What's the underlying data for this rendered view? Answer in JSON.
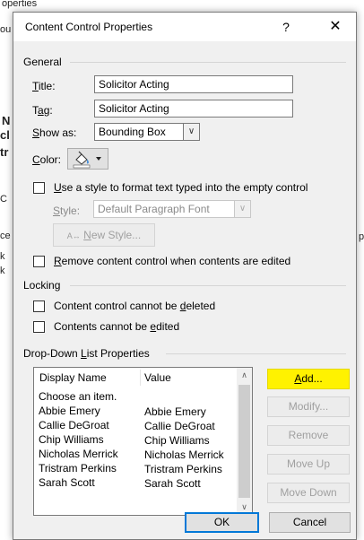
{
  "background_doc": {
    "fragments": [
      "operties",
      "ou",
      "N",
      "cl",
      "tr",
      "C",
      "ce",
      "k",
      "k",
      "p"
    ]
  },
  "dialog": {
    "title": "Content Control Properties",
    "help_glyph": "?",
    "close_glyph": "✕",
    "general": {
      "header": "General",
      "title_label_u": "T",
      "title_label_rest": "itle:",
      "title_value": "Solicitor Acting",
      "tag_label_pre": "T",
      "tag_label_u": "a",
      "tag_label_rest": "g:",
      "tag_value": "Solicitor Acting",
      "show_as_label_u": "S",
      "show_as_label_rest": "how as:",
      "show_as_value": "Bounding Box",
      "color_label_u": "C",
      "color_label_rest": "olor:",
      "use_style_u": "U",
      "use_style_rest": "se a style to format text typed into the empty control",
      "style_label_u": "S",
      "style_label_rest": "tyle:",
      "style_value": "Default Paragraph Font",
      "new_style_u": "N",
      "new_style_rest": "ew Style...",
      "remove_u": "R",
      "remove_rest": "emove content control when contents are edited"
    },
    "locking": {
      "header": "Locking",
      "cannot_delete_pre": "Content control cannot be ",
      "cannot_delete_u": "d",
      "cannot_delete_post": "eleted",
      "cannot_edit_pre": "Contents cannot be ",
      "cannot_edit_u": "e",
      "cannot_edit_post": "dited"
    },
    "dropdown": {
      "header_pre": "Drop-Down ",
      "header_u": "L",
      "header_post": "ist Properties",
      "columns": [
        "Display Name",
        "Value"
      ],
      "rows": [
        {
          "display": "Choose an item.",
          "value": ""
        },
        {
          "display": "Abbie Emery",
          "value": "Abbie Emery"
        },
        {
          "display": "Callie DeGroat",
          "value": "Callie DeGroat"
        },
        {
          "display": "Chip Williams",
          "value": "Chip Williams"
        },
        {
          "display": "Nicholas Merrick",
          "value": "Nicholas Merrick"
        },
        {
          "display": "Tristram Perkins",
          "value": "Tristram Perkins"
        },
        {
          "display": "Sarah Scott",
          "value": "Sarah Scott"
        }
      ],
      "buttons": {
        "add": "Add...",
        "modify": "Modify...",
        "remove": "Remove",
        "move_up": "Move Up",
        "move_down": "Move Down"
      }
    },
    "ok": "OK",
    "cancel": "Cancel"
  },
  "colors": {
    "highlight": "#fff200",
    "focus_border": "#0078d7",
    "dialog_bg": "#f0f0f0"
  }
}
